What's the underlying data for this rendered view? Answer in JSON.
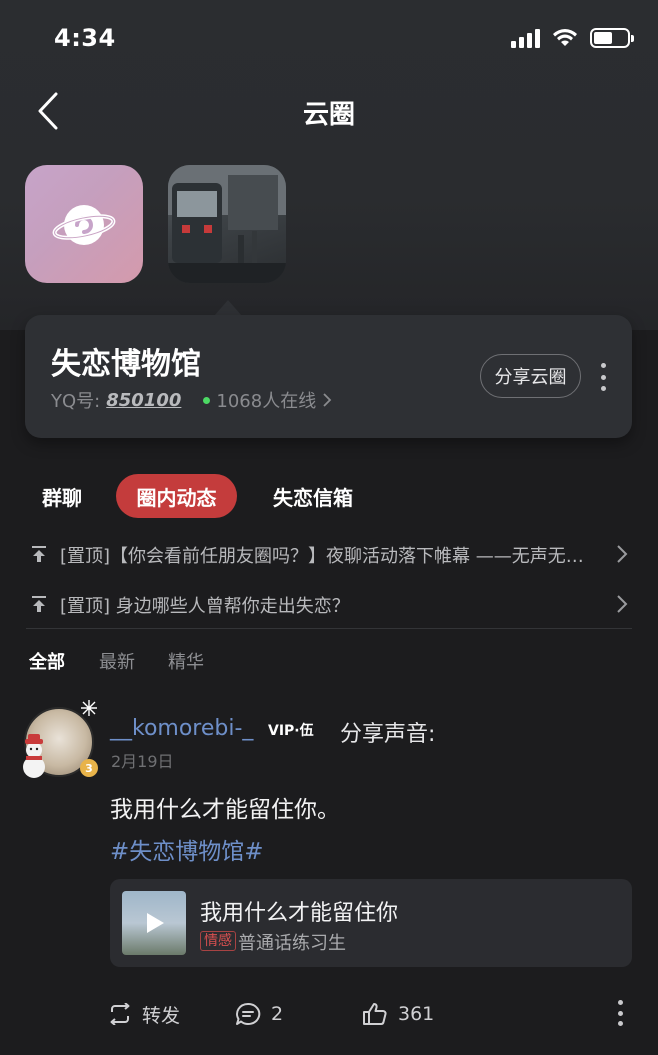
{
  "status_bar": {
    "time": "4:34"
  },
  "nav": {
    "title": "云圈"
  },
  "circle": {
    "name": "失恋博物馆",
    "yq_label": "YQ号:",
    "yq_value": "850100",
    "online": "1068人在线",
    "share_label": "分享云圈"
  },
  "tabs": [
    {
      "label": "群聊"
    },
    {
      "label": "圈内动态",
      "active": true
    },
    {
      "label": "失恋信箱"
    }
  ],
  "pinned": [
    {
      "text": "[置顶]【你会看前任朋友圈吗？】夜聊活动落下帷幕 ——无声无息…"
    },
    {
      "text": "[置顶] 身边哪些人曾帮你走出失恋？"
    }
  ],
  "filters": [
    {
      "label": "全部",
      "active": true
    },
    {
      "label": "最新"
    },
    {
      "label": "精华"
    }
  ],
  "post": {
    "username": "__komorebi-_",
    "vip": "VIP·伍",
    "level": "3",
    "action": "分享声音:",
    "date": "2月19日",
    "text": "我用什么才能留住你。",
    "tag": "#失恋博物馆#",
    "song": {
      "title": "我用什么才能留住你",
      "tag": "情感",
      "subtitle": "普通话练习生"
    },
    "actions": {
      "repost": "转发",
      "comments": "2",
      "likes": "361"
    }
  },
  "colors": {
    "accent": "#c43c3c",
    "link": "#6e8fc9",
    "background": "#1c1c1e",
    "card": "#2e3034",
    "online_dot": "#4cd964"
  }
}
